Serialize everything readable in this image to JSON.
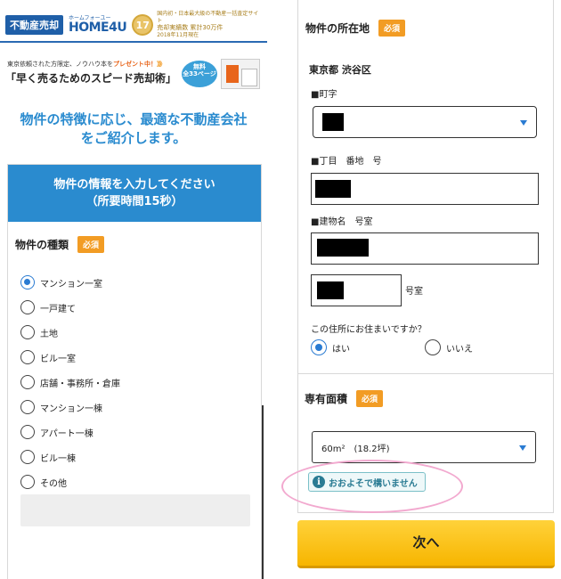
{
  "left": {
    "brand": {
      "badge": "不動産売却",
      "logo_kana": "ホームフォーユー",
      "logo_name": "HOME4U",
      "anniv": "17",
      "text_line1": "国内初・日本最大級の不動産一括査定サイト",
      "text_line2": "売却実績数 累計30万件",
      "text_date": "2018年11月現在"
    },
    "promo": {
      "line1_a": "東京依頼された方限定、ノウハウ本を",
      "line1_highlight": "プレゼント中！",
      "line1_arrows": "》》》",
      "line2": "「早く売るためのスピード売却術」",
      "free_label": "無料",
      "pages_label": "全33ページ"
    },
    "headline_line1": "物件の特徴に応じ、最適な不動産会社",
    "headline_line2": "をご紹介します。",
    "card": {
      "header_line1": "物件の情報を入力してください",
      "header_line2": "（所要時間15秒）",
      "field_label": "物件の種類",
      "required": "必須",
      "options": [
        "マンション一室",
        "一戸建て",
        "土地",
        "ビル一室",
        "店舗・事務所・倉庫",
        "マンション一棟",
        "アパート一棟",
        "ビル一棟",
        "その他"
      ],
      "selected_index": 0
    }
  },
  "right": {
    "location": {
      "label": "物件の所在地",
      "required": "必須",
      "prefecture_city": "東京都 渋谷区",
      "town_label": "■町字",
      "block_label": "■丁目　番地　号",
      "building_label": "■建物名　号室",
      "room_suffix": "号室",
      "question": "この住所にお住まいですか？",
      "yes": "はい",
      "no": "いいえ",
      "resides_selected": "yes"
    },
    "area": {
      "label": "専有面積",
      "required": "必須",
      "selected_value": "60m²　(18.2坪)",
      "approx_note": "おおよそで構いません"
    },
    "next_button": "次へ"
  },
  "colors": {
    "brand_blue": "#1f5fa8",
    "accent_blue": "#2a8bcf",
    "required_orange": "#f29c24",
    "next_yellow": "#f7b500",
    "highlight_pink": "#f2a9cf"
  },
  "icons": {
    "info": "info-icon",
    "dropdown": "caret-down-icon"
  }
}
